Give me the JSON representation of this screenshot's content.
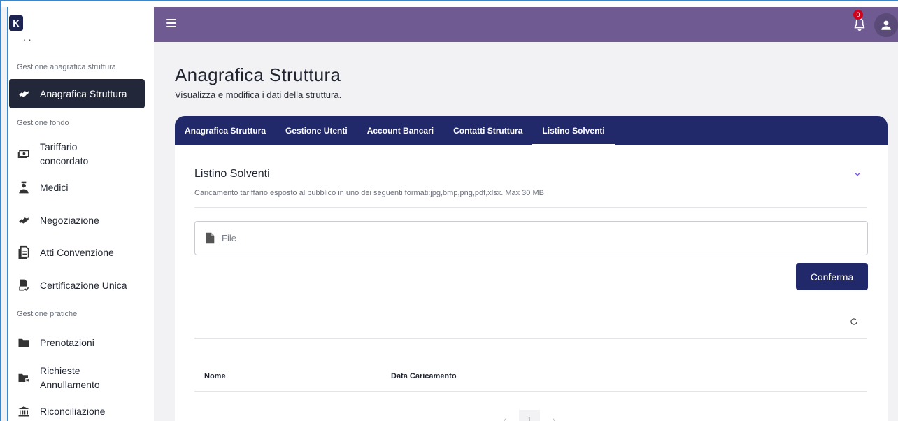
{
  "app": {
    "logo_letter": "K",
    "notifications_count": "0"
  },
  "sidebar": {
    "cut_text": "           ,    ,",
    "sections": [
      {
        "label": "Gestione anagrafica struttura"
      },
      {
        "label": "Gestione fondo"
      },
      {
        "label": "Gestione pratiche"
      }
    ],
    "items": [
      {
        "label": "Anagrafica Struttura",
        "icon": "handshake-icon",
        "active": true
      },
      {
        "label": "Tariffario concordato",
        "icon": "money-icon"
      },
      {
        "label": "Medici",
        "icon": "doctor-icon"
      },
      {
        "label": "Negoziazione",
        "icon": "handshake-icon"
      },
      {
        "label": "Atti Convenzione",
        "icon": "documents-icon"
      },
      {
        "label": "Certificazione Unica",
        "icon": "document-check-icon"
      },
      {
        "label": "Prenotazioni",
        "icon": "folder-icon"
      },
      {
        "label": "Richieste Annullamento",
        "icon": "folder-x-icon"
      },
      {
        "label": "Riconciliazione",
        "icon": "bank-icon"
      }
    ]
  },
  "page": {
    "title": "Anagrafica Struttura",
    "subtitle": "Visualizza e modifica i dati della struttura."
  },
  "tabs": [
    {
      "label": "Anagrafica Struttura"
    },
    {
      "label": "Gestione Utenti"
    },
    {
      "label": "Account Bancari"
    },
    {
      "label": "Contatti Struttura"
    },
    {
      "label": "Listino Solventi",
      "active": true
    }
  ],
  "section": {
    "title": "Listino Solventi",
    "description": "Caricamento tariffario esposto al pubblico in uno dei seguenti formati:jpg,bmp,png,pdf,xlsx. Max 30 MB",
    "file_placeholder": "File",
    "confirm_label": "Conferma"
  },
  "table": {
    "columns": [
      "Nome",
      "Data Caricamento"
    ]
  },
  "pagination": {
    "current_page": "1",
    "prev": "‹",
    "next": "›"
  },
  "colors": {
    "topbar": "#6f5b91",
    "tabs_bar": "#22296a",
    "sidebar_active": "#23273a",
    "badge": "#d0021b"
  }
}
